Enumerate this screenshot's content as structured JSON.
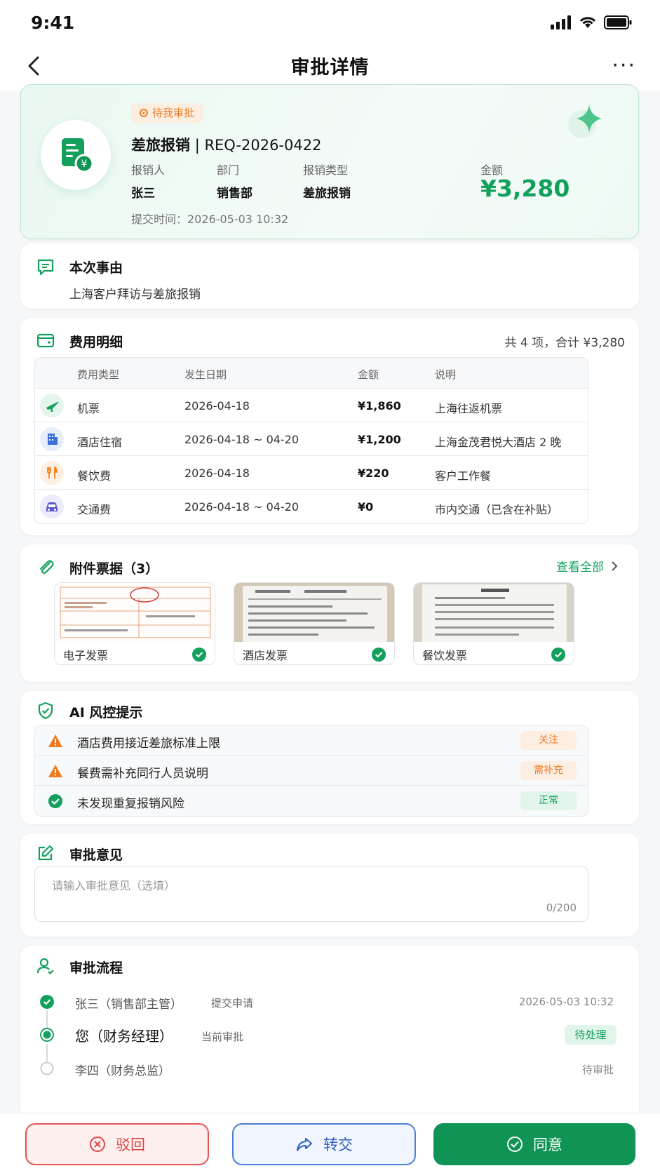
{
  "status": {
    "time": "9:41"
  },
  "nav": {
    "title": "审批详情",
    "more": "···"
  },
  "summary": {
    "badge": "待我审批",
    "type_title": "差旅报销",
    "req_id": "| REQ-2026-0422",
    "fields": [
      {
        "label": "报销人",
        "value": "张三"
      },
      {
        "label": "部门",
        "value": "销售部"
      },
      {
        "label": "报销类型",
        "value": "差旅报销"
      }
    ],
    "amount_label": "金额",
    "amount": "¥3,280",
    "submit_time": "提交时间：2026-05-03 10:32"
  },
  "reason": {
    "title": "本次事由",
    "text": "上海客户拜访与差旅报销"
  },
  "expenses": {
    "title": "费用明细",
    "summary": "共 4 项，合计 ¥3,280",
    "headers": [
      "费用类型",
      "发生日期",
      "金额",
      "说明"
    ],
    "rows": [
      {
        "icon": "plane-icon",
        "type": "机票",
        "date": "2026-04-18",
        "amount": "¥1,860",
        "note": "上海往返机票",
        "color": "#e5f5ec",
        "fg": "#13a05c"
      },
      {
        "icon": "hotel-icon",
        "type": "酒店住宿",
        "date": "2026-04-18 ~ 04-20",
        "amount": "¥1,200",
        "note": "上海金茂君悦大酒店 2 晚",
        "color": "#e6eefc",
        "fg": "#3b6fd9"
      },
      {
        "icon": "dining-icon",
        "type": "餐饮费",
        "date": "2026-04-18",
        "amount": "¥220",
        "note": "客户工作餐",
        "color": "#fdf0e3",
        "fg": "#f0841e"
      },
      {
        "icon": "car-icon",
        "type": "交通费",
        "date": "2026-04-18 ~ 04-20",
        "amount": "¥0",
        "note": "市内交通（已含在补贴）",
        "color": "#ecebfb",
        "fg": "#5b57cf"
      }
    ]
  },
  "attachments": {
    "title": "附件票据（3）",
    "view_all": "查看全部",
    "items": [
      {
        "label": "电子发票"
      },
      {
        "label": "酒店发票"
      },
      {
        "label": "餐饮发票"
      }
    ]
  },
  "risk": {
    "title": "AI 风控提示",
    "items": [
      {
        "text": "酒店费用接近差旅标准上限",
        "tag": "关注",
        "level": "warn"
      },
      {
        "text": "餐费需补充同行人员说明",
        "tag": "需补充",
        "level": "warn"
      },
      {
        "text": "未发现重复报销风险",
        "tag": "正常",
        "level": "ok"
      }
    ]
  },
  "opinion": {
    "title": "审批意见",
    "placeholder": "请输入审批意见（选填）",
    "counter": "0/200"
  },
  "flow": {
    "title": "审批流程",
    "steps": [
      {
        "name": "张三（销售部主管）",
        "action": "提交申请",
        "right": "2026-05-03 10:32",
        "state": "done"
      },
      {
        "name": "您（财务经理）",
        "action": "当前审批",
        "right": "待处理",
        "state": "current"
      },
      {
        "name": "李四（财务总监）",
        "action": "",
        "right": "待审批",
        "state": "todo"
      }
    ]
  },
  "actions": {
    "reject": "驳回",
    "transfer": "转交",
    "agree": "同意"
  },
  "colors": {
    "primary": "#0f9455",
    "warn": "#f07a21",
    "danger": "#e04545",
    "info": "#2f5fbf"
  }
}
